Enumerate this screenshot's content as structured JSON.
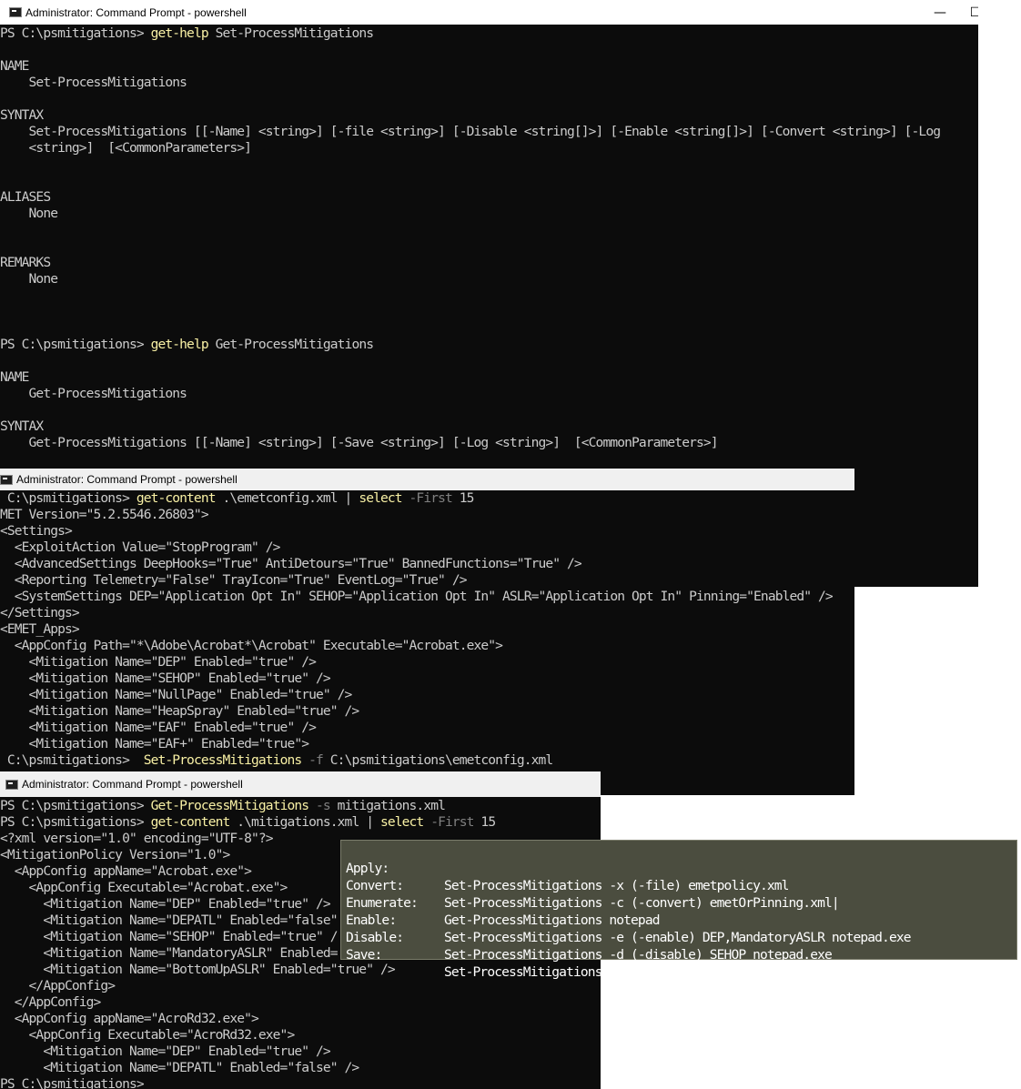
{
  "window1": {
    "title": "Administrator: Command Prompt - powershell",
    "minimize_glyph": "—",
    "maximize_glyph": "☐",
    "lines": [
      [
        {
          "t": "PS C:\\psmitigations> ",
          "c": "w"
        },
        {
          "t": "get-help",
          "c": "y"
        },
        {
          "t": " Set-ProcessMitigations",
          "c": "w"
        }
      ],
      [],
      [
        {
          "t": "NAME",
          "c": "w"
        }
      ],
      [
        {
          "t": "    Set-ProcessMitigations",
          "c": "w"
        }
      ],
      [],
      [
        {
          "t": "SYNTAX",
          "c": "w"
        }
      ],
      [
        {
          "t": "    Set-ProcessMitigations [[-Name] <string>] [-file <string>] [-Disable <string[]>] [-Enable <string[]>] [-Convert <string>] [-Log",
          "c": "w"
        }
      ],
      [
        {
          "t": "    <string>]  [<CommonParameters>]",
          "c": "w"
        }
      ],
      [],
      [],
      [
        {
          "t": "ALIASES",
          "c": "w"
        }
      ],
      [
        {
          "t": "    None",
          "c": "w"
        }
      ],
      [],
      [],
      [
        {
          "t": "REMARKS",
          "c": "w"
        }
      ],
      [
        {
          "t": "    None",
          "c": "w"
        }
      ],
      [],
      [],
      [],
      [
        {
          "t": "PS C:\\psmitigations> ",
          "c": "w"
        },
        {
          "t": "get-help",
          "c": "y"
        },
        {
          "t": " Get-ProcessMitigations",
          "c": "w"
        }
      ],
      [],
      [
        {
          "t": "NAME",
          "c": "w"
        }
      ],
      [
        {
          "t": "    Get-ProcessMitigations",
          "c": "w"
        }
      ],
      [],
      [
        {
          "t": "SYNTAX",
          "c": "w"
        }
      ],
      [
        {
          "t": "    Get-ProcessMitigations [[-Name] <string>] [-Save <string>] [-Log <string>]  [<CommonParameters>]",
          "c": "w"
        }
      ]
    ]
  },
  "window2": {
    "title": "Administrator: Command Prompt - powershell",
    "lines": [
      [
        {
          "t": " C:\\psmitigations> ",
          "c": "w"
        },
        {
          "t": "get-content",
          "c": "y"
        },
        {
          "t": " .\\emetconfig.xml | ",
          "c": "w"
        },
        {
          "t": "select",
          "c": "y"
        },
        {
          "t": " -First",
          "c": "g"
        },
        {
          "t": " 15",
          "c": "w"
        }
      ],
      [
        {
          "t": "MET Version=\"5.2.5546.26803\">",
          "c": "w"
        }
      ],
      [
        {
          "t": "<Settings>",
          "c": "w"
        }
      ],
      [
        {
          "t": "  <ExploitAction Value=\"StopProgram\" />",
          "c": "w"
        }
      ],
      [
        {
          "t": "  <AdvancedSettings DeepHooks=\"True\" AntiDetours=\"True\" BannedFunctions=\"True\" />",
          "c": "w"
        }
      ],
      [
        {
          "t": "  <Reporting Telemetry=\"False\" TrayIcon=\"True\" EventLog=\"True\" />",
          "c": "w"
        }
      ],
      [
        {
          "t": "  <SystemSettings DEP=\"Application Opt In\" SEHOP=\"Application Opt In\" ASLR=\"Application Opt In\" Pinning=\"Enabled\" />",
          "c": "w"
        }
      ],
      [
        {
          "t": "</Settings>",
          "c": "w"
        }
      ],
      [
        {
          "t": "<EMET_Apps>",
          "c": "w"
        }
      ],
      [
        {
          "t": "  <AppConfig Path=\"*\\Adobe\\Acrobat*\\Acrobat\" Executable=\"Acrobat.exe\">",
          "c": "w"
        }
      ],
      [
        {
          "t": "    <Mitigation Name=\"DEP\" Enabled=\"true\" />",
          "c": "w"
        }
      ],
      [
        {
          "t": "    <Mitigation Name=\"SEHOP\" Enabled=\"true\" />",
          "c": "w"
        }
      ],
      [
        {
          "t": "    <Mitigation Name=\"NullPage\" Enabled=\"true\" />",
          "c": "w"
        }
      ],
      [
        {
          "t": "    <Mitigation Name=\"HeapSpray\" Enabled=\"true\" />",
          "c": "w"
        }
      ],
      [
        {
          "t": "    <Mitigation Name=\"EAF\" Enabled=\"true\" />",
          "c": "w"
        }
      ],
      [
        {
          "t": "    <Mitigation Name=\"EAF+\" Enabled=\"true\">",
          "c": "w"
        }
      ],
      [
        {
          "t": " C:\\psmitigations>  ",
          "c": "w"
        },
        {
          "t": "Set-ProcessMitigations",
          "c": "y"
        },
        {
          "t": " -f",
          "c": "g"
        },
        {
          "t": " C:\\psmitigations\\emetconfig.xml",
          "c": "w"
        }
      ]
    ]
  },
  "window3": {
    "title": "Administrator: Command Prompt - powershell",
    "lines": [
      [
        {
          "t": "PS C:\\psmitigations> ",
          "c": "w"
        },
        {
          "t": "Get-ProcessMitigations",
          "c": "y"
        },
        {
          "t": " -s",
          "c": "g"
        },
        {
          "t": " mitigations.xml",
          "c": "w"
        }
      ],
      [
        {
          "t": "PS C:\\psmitigations> ",
          "c": "w"
        },
        {
          "t": "get-content",
          "c": "y"
        },
        {
          "t": " .\\mitigations.xml | ",
          "c": "w"
        },
        {
          "t": "select",
          "c": "y"
        },
        {
          "t": " -First",
          "c": "g"
        },
        {
          "t": " 15",
          "c": "w"
        }
      ],
      [
        {
          "t": "<?xml version=\"1.0\" encoding=\"UTF-8\"?>",
          "c": "w"
        }
      ],
      [
        {
          "t": "<MitigationPolicy Version=\"1.0\">",
          "c": "w"
        }
      ],
      [
        {
          "t": "  <AppConfig appName=\"Acrobat.exe\">",
          "c": "w"
        }
      ],
      [
        {
          "t": "    <AppConfig Executable=\"Acrobat.exe\">",
          "c": "w"
        }
      ],
      [
        {
          "t": "      <Mitigation Name=\"DEP\" Enabled=\"true\" />",
          "c": "w"
        }
      ],
      [
        {
          "t": "      <Mitigation Name=\"DEPATL\" Enabled=\"false\"",
          "c": "w"
        }
      ],
      [
        {
          "t": "      <Mitigation Name=\"SEHOP\" Enabled=\"true\" /",
          "c": "w"
        }
      ],
      [
        {
          "t": "      <Mitigation Name=\"MandatoryASLR\" Enabled=",
          "c": "w"
        }
      ],
      [
        {
          "t": "      <Mitigation Name=\"BottomUpASLR\" Enabled=\"true\" />",
          "c": "w"
        }
      ],
      [
        {
          "t": "    </AppConfig>",
          "c": "w"
        }
      ],
      [
        {
          "t": "  </AppConfig>",
          "c": "w"
        }
      ],
      [
        {
          "t": "  <AppConfig appName=\"AcroRd32.exe\">",
          "c": "w"
        }
      ],
      [
        {
          "t": "    <AppConfig Executable=\"AcroRd32.exe\">",
          "c": "w"
        }
      ],
      [
        {
          "t": "      <Mitigation Name=\"DEP\" Enabled=\"true\" />",
          "c": "w"
        }
      ],
      [
        {
          "t": "      <Mitigation Name=\"DEPATL\" Enabled=\"false\" />",
          "c": "w"
        }
      ],
      [
        {
          "t": "PS C:\\psmitigations>",
          "c": "w"
        }
      ]
    ]
  },
  "tooltip": {
    "rows": [
      {
        "key": "Apply:",
        "value": "Set-ProcessMitigations -x (-file) emetpolicy.xml"
      },
      {
        "key": "Convert:",
        "value": "Set-ProcessMitigations -c (-convert) emetOrPinning.xml|"
      },
      {
        "key": "Enumerate:",
        "value": "Get-ProcessMitigations notepad"
      },
      {
        "key": "Enable:",
        "value": "Set-ProcessMitigations -e (-enable) DEP,MandatoryASLR notepad.exe"
      },
      {
        "key": "Disable:",
        "value": "Set-ProcessMitigations -d (-disable) SEHOP notepad.exe"
      },
      {
        "key": "Save:",
        "value": "Set-ProcessMitigations -s (-save) FileName.xml"
      }
    ]
  }
}
